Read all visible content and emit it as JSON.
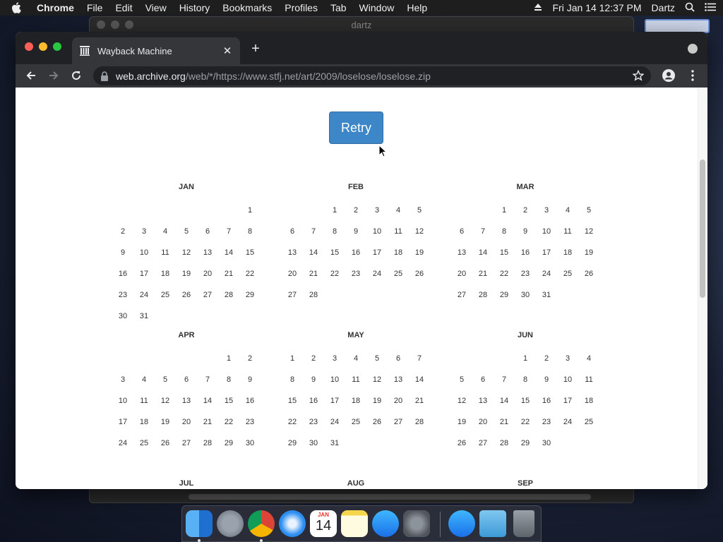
{
  "menubar": {
    "app": "Chrome",
    "items": [
      "File",
      "Edit",
      "View",
      "History",
      "Bookmarks",
      "Profiles",
      "Tab",
      "Window",
      "Help"
    ],
    "datetime": "Fri Jan 14  12:37 PM",
    "user": "Dartz"
  },
  "background_window": {
    "title": "dartz"
  },
  "browser": {
    "tab_title": "Wayback Machine",
    "url_host": "web.archive.org",
    "url_path": "/web/*/https://www.stfj.net/art/2009/loselose/loselose.zip"
  },
  "page": {
    "retry_label": "Retry",
    "months": [
      {
        "name": "JAN",
        "offset": 6,
        "days": 31
      },
      {
        "name": "FEB",
        "offset": 2,
        "days": 28
      },
      {
        "name": "MAR",
        "offset": 2,
        "days": 31
      },
      {
        "name": "APR",
        "offset": 5,
        "days": 30
      },
      {
        "name": "MAY",
        "offset": 0,
        "days": 31
      },
      {
        "name": "JUN",
        "offset": 3,
        "days": 30
      },
      {
        "name": "JUL",
        "offset": 5,
        "days": 0
      },
      {
        "name": "AUG",
        "offset": 1,
        "days": 0
      },
      {
        "name": "SEP",
        "offset": 4,
        "days": 0
      }
    ]
  },
  "dock": {
    "apps": [
      "finder-icon",
      "launchpad-icon",
      "chrome-icon",
      "safari-icon",
      "calendar-icon",
      "notes-icon",
      "app-store-icon",
      "system-preferences-icon",
      "app-store-download-icon",
      "downloads-folder-icon",
      "trash-icon"
    ],
    "calendar_month": "JAN",
    "calendar_day": "14"
  }
}
